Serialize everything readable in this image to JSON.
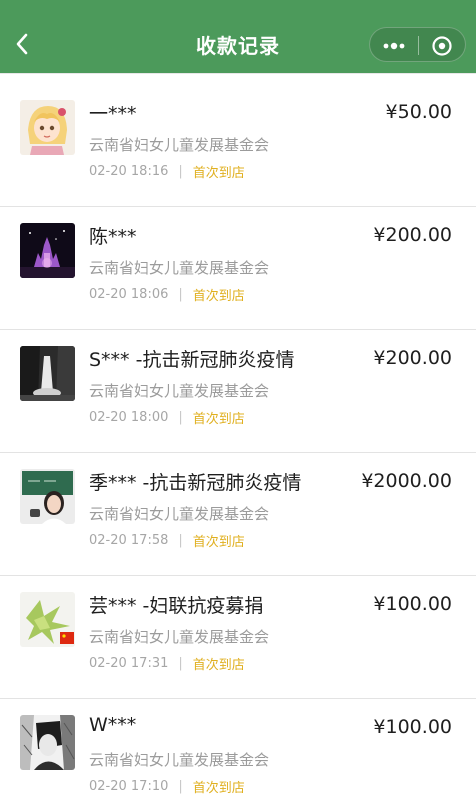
{
  "navbar": {
    "title": "收款记录",
    "back_icon": "chevron-left-icon",
    "more_icon": "more-dots-icon",
    "close_icon": "target-circle-icon",
    "background": "#4c9a5b"
  },
  "records": [
    {
      "name": "一***",
      "amount": "¥50.00",
      "org": "云南省妇女儿童发展基金会",
      "time": "02-20 18:16",
      "tag": "首次到店",
      "avatar": "anime-girl-avatar"
    },
    {
      "name": "陈***",
      "amount": "¥200.00",
      "org": "云南省妇女儿童发展基金会",
      "time": "02-20 18:06",
      "tag": "首次到店",
      "avatar": "night-castle-avatar"
    },
    {
      "name": "S*** -抗击新冠肺炎疫情",
      "amount": "¥200.00",
      "org": "云南省妇女儿童发展基金会",
      "time": "02-20 18:00",
      "tag": "首次到店",
      "avatar": "waterfall-avatar"
    },
    {
      "name": "季*** -抗击新冠肺炎疫情",
      "amount": "¥2000.00",
      "org": "云南省妇女儿童发展基金会",
      "time": "02-20 17:58",
      "tag": "首次到店",
      "avatar": "girl-blackboard-avatar"
    },
    {
      "name": "芸*** -妇联抗疫募捐",
      "amount": "¥100.00",
      "org": "云南省妇女儿童发展基金会",
      "time": "02-20 17:31",
      "tag": "首次到店",
      "avatar": "starfruit-flag-avatar"
    },
    {
      "name": "W***",
      "amount": "¥100.00",
      "org": "云南省妇女儿童发展基金会",
      "time": "02-20 17:10",
      "tag": "首次到店",
      "avatar": "sketch-portrait-avatar"
    }
  ],
  "colors": {
    "tag": "#e0b020",
    "secondary_text": "#9b9b9b"
  }
}
